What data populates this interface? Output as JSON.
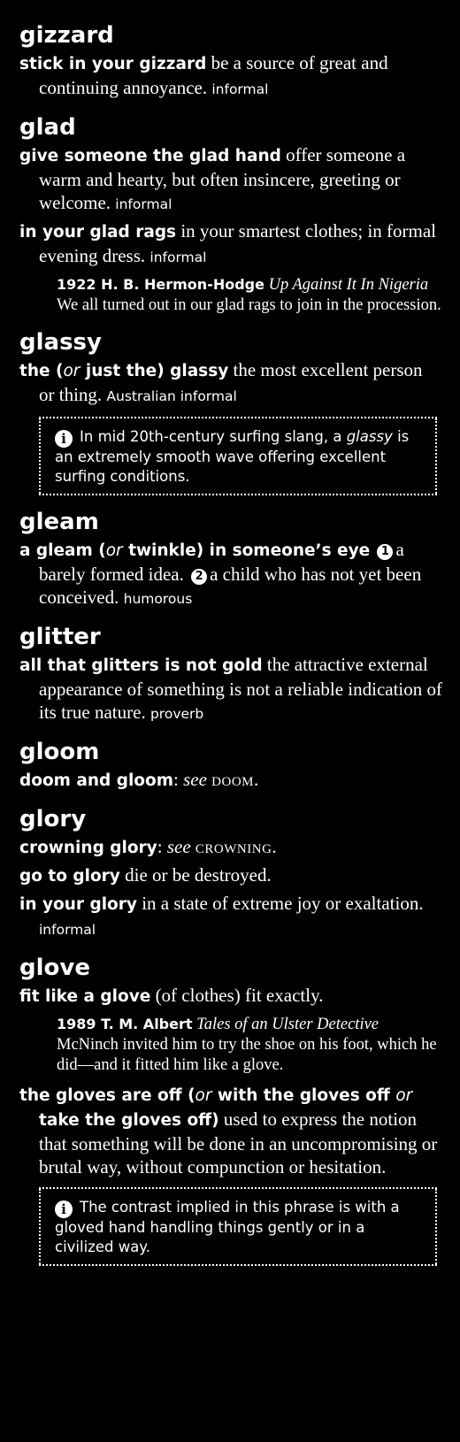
{
  "entries": {
    "gizzard": {
      "headword": "gizzard",
      "s1": {
        "phrase": "stick in your gizzard",
        "def": " be a source of great and continuing annoyance. ",
        "label": "informal"
      }
    },
    "glad": {
      "headword": "glad",
      "s1": {
        "phrase": "give someone the glad hand",
        "def": " offer someone a warm and hearty, but often insincere, greeting or welcome. ",
        "label": "informal"
      },
      "s2": {
        "phrase": "in your glad rags",
        "def": " in your smartest clothes; in formal evening dress. ",
        "label": "informal",
        "quote": {
          "source": "1922 H. B. Hermon-Hodge",
          "title": "Up Against It In Nigeria",
          "text": " We all turned out in our glad rags to join in the procession."
        }
      }
    },
    "glassy": {
      "headword": "glassy",
      "s1": {
        "p1": "the (",
        "or": "or",
        "p2": " just the) glassy",
        "def": " the most excellent person or thing. ",
        "label": "Australian informal"
      },
      "note": {
        "icon": "info-icon",
        "t1": "In mid 20th-century surfing slang, a ",
        "em": "glassy",
        "t2": " is an extremely smooth wave offering excellent surfing conditions."
      }
    },
    "gleam": {
      "headword": "gleam",
      "s1": {
        "p1": "a gleam (",
        "or": "or",
        "p2": " twinkle) in someone’s eye",
        "n1": "1",
        "d1": "a barely formed idea. ",
        "n2": "2",
        "d2": "a child who has not yet been conceived. ",
        "label": "humorous"
      }
    },
    "glitter": {
      "headword": "glitter",
      "s1": {
        "phrase": "all that glitters is not gold",
        "def": " the attractive external appearance of something is not a reliable indication of its true nature. ",
        "label": "proverb"
      }
    },
    "gloom": {
      "headword": "gloom",
      "s1": {
        "phrase": "doom and gloom",
        "colon": ": ",
        "see": "see",
        "ref": "doom",
        "end": "."
      }
    },
    "glory": {
      "headword": "glory",
      "s1": {
        "phrase": "crowning glory",
        "colon": ": ",
        "see": "see",
        "ref": "crowning",
        "end": "."
      },
      "s2": {
        "phrase": "go to glory",
        "def": " die or be destroyed."
      },
      "s3": {
        "phrase": "in your glory",
        "def": " in a state of extreme joy or exaltation. ",
        "label": "informal"
      }
    },
    "glove": {
      "headword": "glove",
      "s1": {
        "phrase": "fit like a glove",
        "def": " (of clothes) fit exactly.",
        "quote": {
          "source": "1989 T. M. Albert",
          "title": "Tales of an Ulster Detective",
          "text": " McNinch invited him to try the shoe on his foot, which he did—and it fitted him like a glove."
        }
      },
      "s2": {
        "p1": "the gloves are off (",
        "or1": "or",
        "p2": " with the gloves off ",
        "or2": "or",
        "p3": " take the gloves off)",
        "def": " used to express the notion that something will be done in an uncompromising or brutal way, without compunction or hesitation."
      },
      "note": {
        "icon": "info-icon",
        "text": "The contrast implied in this phrase is with a gloved hand handling things gently or in a civilized way."
      }
    }
  }
}
